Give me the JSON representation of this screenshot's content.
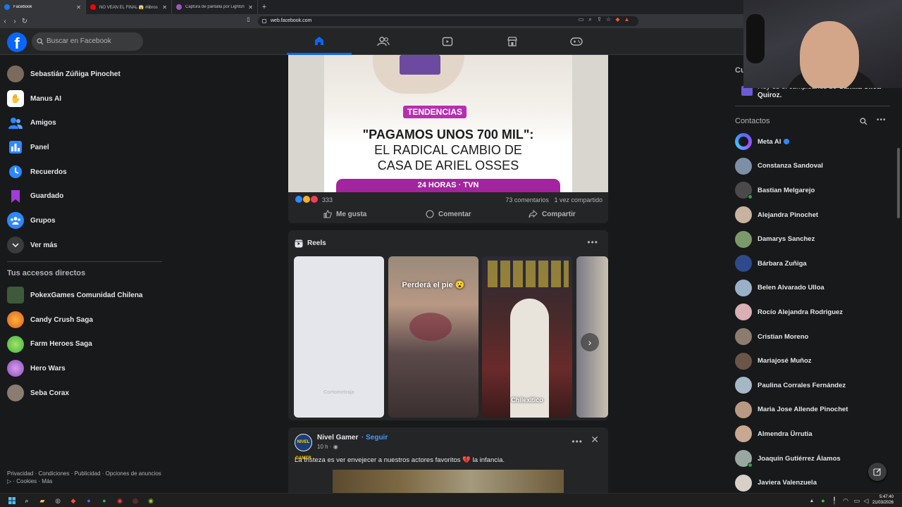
{
  "browser": {
    "tabs": [
      {
        "title": "Facebook",
        "color": "#1877f2",
        "active": true
      },
      {
        "title": "NO VEAN EL FINAL 😱 #libros #ficci",
        "color": "#ff0000",
        "active": false
      },
      {
        "title": "Captura de pantalla por Lightshot",
        "color": "#9b59b6",
        "active": false
      }
    ],
    "url": "web.facebook.com"
  },
  "header": {
    "logo": "f",
    "search_placeholder": "Buscar en Facebook",
    "nav_icons": [
      "home-icon",
      "friends-icon",
      "video-icon",
      "marketplace-icon",
      "gaming-icon"
    ]
  },
  "sidebar": {
    "items": [
      {
        "label": "Sebastián Zúñiga Pinochet",
        "icon": "avatar",
        "color": "#7a6b5d"
      },
      {
        "label": "Manus AI",
        "icon": "manus-icon",
        "color": "#ffffff"
      },
      {
        "label": "Amigos",
        "icon": "friends-icon",
        "color": "#2d88ff"
      },
      {
        "label": "Panel",
        "icon": "dashboard-icon",
        "color": "#2d88ff"
      },
      {
        "label": "Recuerdos",
        "icon": "clock-icon",
        "color": "#2d88ff"
      },
      {
        "label": "Guardado",
        "icon": "bookmark-icon",
        "color": "#a53bd6"
      },
      {
        "label": "Grupos",
        "icon": "groups-icon",
        "color": "#2d88ff"
      },
      {
        "label": "Ver más",
        "icon": "chevron-down-icon",
        "color": "#3a3b3c"
      }
    ],
    "shortcuts_title": "Tus accesos directos",
    "shortcuts": [
      {
        "label": "PokexGames Comunidad Chilena",
        "color": "#3d5a3a"
      },
      {
        "label": "Candy Crush Saga",
        "color": "#e45a2a"
      },
      {
        "label": "Farm Heroes Saga",
        "color": "#3ab54a"
      },
      {
        "label": "Hero Wars",
        "color": "#8a4fb8"
      },
      {
        "label": "Seba Corax",
        "color": "#8a7c70"
      }
    ],
    "footer": "Privacidad · Condiciones · Publicidad · Opciones de anuncios ▷ · Cookies · Más"
  },
  "post1": {
    "badge": "TENDENCIAS",
    "headline_line1": "\"PAGAMOS UNOS 700 MIL\":",
    "headline_line2": "EL RADICAL CAMBIO DE",
    "headline_line3": "CASA DE ARIEL OSSES",
    "brand": "24 HORAS · TVN",
    "reaction_count": "333",
    "comments": "73 comentarios",
    "shares": "1 vez compartido",
    "actions": {
      "like": "Me gusta",
      "comment": "Comentar",
      "share": "Compartir"
    }
  },
  "reels": {
    "title": "Reels",
    "items": [
      {
        "caption": "Cortometraje",
        "bg": "#e4e6eb"
      },
      {
        "caption": "Perderá el pie 😮",
        "bg": "#6d5a4a"
      },
      {
        "caption": "Chilexitico",
        "bg": "#3a2a2a"
      },
      {
        "caption": "",
        "bg": "#8f8f9a"
      }
    ]
  },
  "post2": {
    "avatar_text": "NIVEL GAMER",
    "author": "Nivel Gamer",
    "follow": "Seguir",
    "time": "10 h",
    "text": "La tristeza es ver envejecer a nuestros actores favoritos 💔 la infancia."
  },
  "right": {
    "birthday_title": "Cumpleaños",
    "birthday_text_pre": "Hoy es el cumpleaños de ",
    "birthday_name": "Camila Ulloa Quiroz.",
    "contacts_title": "Contactos",
    "contacts": [
      {
        "name": "Meta AI",
        "color": "#4f6bff",
        "online": false
      },
      {
        "name": "Constanza Sandoval",
        "color": "#7d8fa6",
        "online": false
      },
      {
        "name": "Bastian Melgarejo",
        "color": "#4a4a4a",
        "online": true
      },
      {
        "name": "Alejandra Pinochet",
        "color": "#c8b3a0",
        "online": false
      },
      {
        "name": "Damarys Sanchez",
        "color": "#7a9a6a",
        "online": false
      },
      {
        "name": "Bárbara Zuñiga",
        "color": "#2f4a8a",
        "online": false
      },
      {
        "name": "Belen Alvarado Ulloa",
        "color": "#9ab0c8",
        "online": false
      },
      {
        "name": "Rocío Alejandra Rodriguez",
        "color": "#d8b0b6",
        "online": false
      },
      {
        "name": "Cristian Moreno",
        "color": "#8c7c70",
        "online": false
      },
      {
        "name": "Mariajosé Muñoz",
        "color": "#6b5448",
        "online": false
      },
      {
        "name": "Paulina Corrales Fernández",
        "color": "#a6b8c6",
        "online": false
      },
      {
        "name": "Maria Jose Allende Pinochet",
        "color": "#b89a84",
        "online": false
      },
      {
        "name": "Almendra Ürrutia",
        "color": "#c8a890",
        "online": false
      },
      {
        "name": "Joaquín Gutiérrez Álamos",
        "color": "#9aa6a0",
        "online": true
      },
      {
        "name": "Javiera Valenzuela",
        "color": "#d8cfc8",
        "online": false
      }
    ]
  },
  "taskbar": {
    "time": "5:47:40",
    "date": "21/03/2026"
  }
}
